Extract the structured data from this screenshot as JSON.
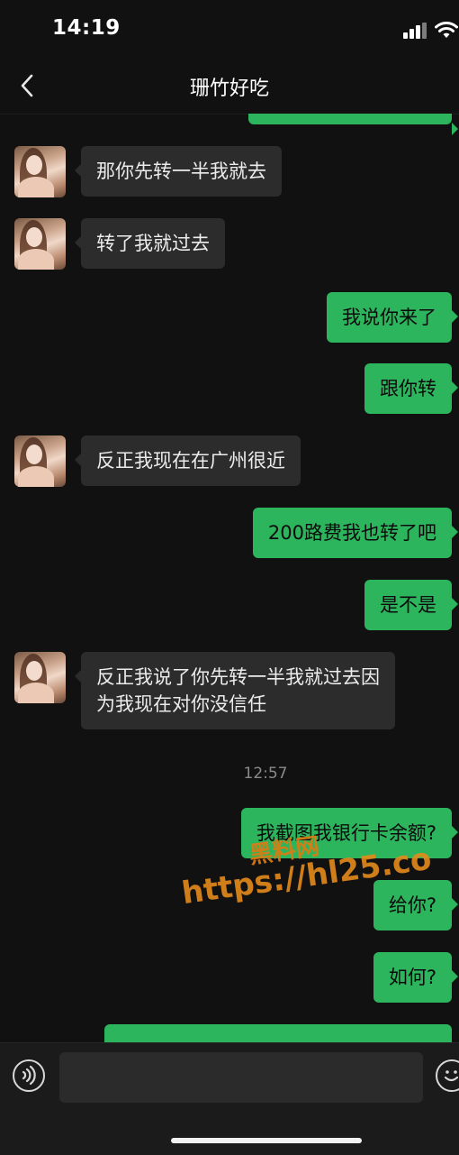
{
  "status": {
    "time": "14:19"
  },
  "header": {
    "title": "珊竹好吃"
  },
  "messages": [
    {
      "id": "m1",
      "side": "in",
      "text": "那你先转一半我就去"
    },
    {
      "id": "m2",
      "side": "in",
      "text": "转了我就过去"
    },
    {
      "id": "m3",
      "side": "out",
      "text": "我说你来了"
    },
    {
      "id": "m4",
      "side": "out",
      "text": "跟你转"
    },
    {
      "id": "m5",
      "side": "in",
      "text": "反正我现在在广州很近"
    },
    {
      "id": "m6",
      "side": "out",
      "text": "200路费我也转了吧"
    },
    {
      "id": "m7",
      "side": "out",
      "text": "是不是"
    },
    {
      "id": "m8",
      "side": "in",
      "lines": [
        "反正我说了你先转一半我就过去因",
        "为我现在对你没信任"
      ]
    },
    {
      "id": "m9",
      "side": "out",
      "text": "我截图我银行卡余额?"
    },
    {
      "id": "m10",
      "side": "out",
      "text": "给你?"
    },
    {
      "id": "m11",
      "side": "out",
      "text": "如何?"
    }
  ],
  "timestamp": "12:57",
  "watermark": {
    "line1": "黑料网",
    "line2": "https://hl25.co"
  },
  "input": {
    "placeholder": ""
  }
}
